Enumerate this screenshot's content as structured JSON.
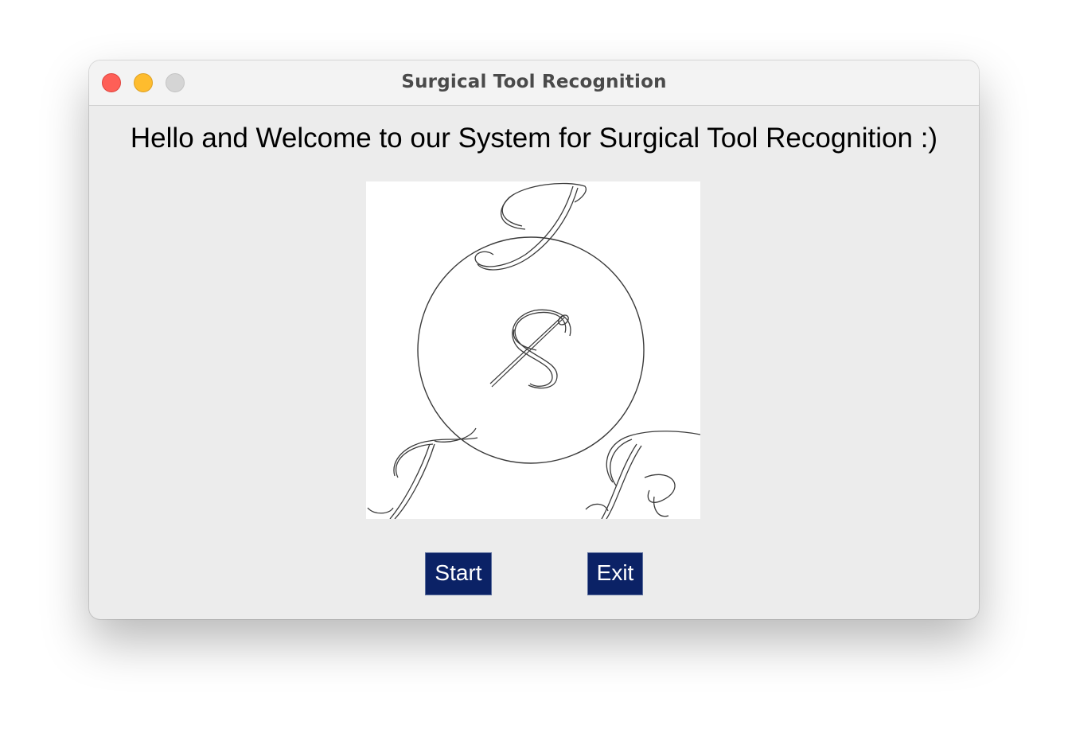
{
  "window": {
    "title": "Surgical Tool Recognition"
  },
  "main": {
    "welcome_text": "Hello and Welcome to our System for Surgical Tool Recognition :)",
    "logo_icon": "str-monogram-logo"
  },
  "buttons": {
    "start_label": "Start",
    "exit_label": "Exit",
    "color": "#0b2266"
  }
}
